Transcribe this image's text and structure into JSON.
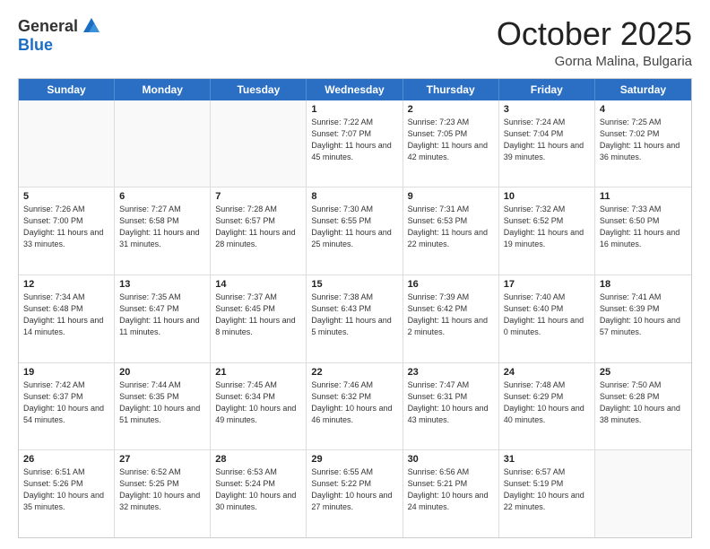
{
  "header": {
    "logo": {
      "general": "General",
      "blue": "Blue"
    },
    "title": "October 2025",
    "subtitle": "Gorna Malina, Bulgaria"
  },
  "days": [
    "Sunday",
    "Monday",
    "Tuesday",
    "Wednesday",
    "Thursday",
    "Friday",
    "Saturday"
  ],
  "weeks": [
    [
      {
        "date": "",
        "info": ""
      },
      {
        "date": "",
        "info": ""
      },
      {
        "date": "",
        "info": ""
      },
      {
        "date": "1",
        "info": "Sunrise: 7:22 AM\nSunset: 7:07 PM\nDaylight: 11 hours and 45 minutes."
      },
      {
        "date": "2",
        "info": "Sunrise: 7:23 AM\nSunset: 7:05 PM\nDaylight: 11 hours and 42 minutes."
      },
      {
        "date": "3",
        "info": "Sunrise: 7:24 AM\nSunset: 7:04 PM\nDaylight: 11 hours and 39 minutes."
      },
      {
        "date": "4",
        "info": "Sunrise: 7:25 AM\nSunset: 7:02 PM\nDaylight: 11 hours and 36 minutes."
      }
    ],
    [
      {
        "date": "5",
        "info": "Sunrise: 7:26 AM\nSunset: 7:00 PM\nDaylight: 11 hours and 33 minutes."
      },
      {
        "date": "6",
        "info": "Sunrise: 7:27 AM\nSunset: 6:58 PM\nDaylight: 11 hours and 31 minutes."
      },
      {
        "date": "7",
        "info": "Sunrise: 7:28 AM\nSunset: 6:57 PM\nDaylight: 11 hours and 28 minutes."
      },
      {
        "date": "8",
        "info": "Sunrise: 7:30 AM\nSunset: 6:55 PM\nDaylight: 11 hours and 25 minutes."
      },
      {
        "date": "9",
        "info": "Sunrise: 7:31 AM\nSunset: 6:53 PM\nDaylight: 11 hours and 22 minutes."
      },
      {
        "date": "10",
        "info": "Sunrise: 7:32 AM\nSunset: 6:52 PM\nDaylight: 11 hours and 19 minutes."
      },
      {
        "date": "11",
        "info": "Sunrise: 7:33 AM\nSunset: 6:50 PM\nDaylight: 11 hours and 16 minutes."
      }
    ],
    [
      {
        "date": "12",
        "info": "Sunrise: 7:34 AM\nSunset: 6:48 PM\nDaylight: 11 hours and 14 minutes."
      },
      {
        "date": "13",
        "info": "Sunrise: 7:35 AM\nSunset: 6:47 PM\nDaylight: 11 hours and 11 minutes."
      },
      {
        "date": "14",
        "info": "Sunrise: 7:37 AM\nSunset: 6:45 PM\nDaylight: 11 hours and 8 minutes."
      },
      {
        "date": "15",
        "info": "Sunrise: 7:38 AM\nSunset: 6:43 PM\nDaylight: 11 hours and 5 minutes."
      },
      {
        "date": "16",
        "info": "Sunrise: 7:39 AM\nSunset: 6:42 PM\nDaylight: 11 hours and 2 minutes."
      },
      {
        "date": "17",
        "info": "Sunrise: 7:40 AM\nSunset: 6:40 PM\nDaylight: 11 hours and 0 minutes."
      },
      {
        "date": "18",
        "info": "Sunrise: 7:41 AM\nSunset: 6:39 PM\nDaylight: 10 hours and 57 minutes."
      }
    ],
    [
      {
        "date": "19",
        "info": "Sunrise: 7:42 AM\nSunset: 6:37 PM\nDaylight: 10 hours and 54 minutes."
      },
      {
        "date": "20",
        "info": "Sunrise: 7:44 AM\nSunset: 6:35 PM\nDaylight: 10 hours and 51 minutes."
      },
      {
        "date": "21",
        "info": "Sunrise: 7:45 AM\nSunset: 6:34 PM\nDaylight: 10 hours and 49 minutes."
      },
      {
        "date": "22",
        "info": "Sunrise: 7:46 AM\nSunset: 6:32 PM\nDaylight: 10 hours and 46 minutes."
      },
      {
        "date": "23",
        "info": "Sunrise: 7:47 AM\nSunset: 6:31 PM\nDaylight: 10 hours and 43 minutes."
      },
      {
        "date": "24",
        "info": "Sunrise: 7:48 AM\nSunset: 6:29 PM\nDaylight: 10 hours and 40 minutes."
      },
      {
        "date": "25",
        "info": "Sunrise: 7:50 AM\nSunset: 6:28 PM\nDaylight: 10 hours and 38 minutes."
      }
    ],
    [
      {
        "date": "26",
        "info": "Sunrise: 6:51 AM\nSunset: 5:26 PM\nDaylight: 10 hours and 35 minutes."
      },
      {
        "date": "27",
        "info": "Sunrise: 6:52 AM\nSunset: 5:25 PM\nDaylight: 10 hours and 32 minutes."
      },
      {
        "date": "28",
        "info": "Sunrise: 6:53 AM\nSunset: 5:24 PM\nDaylight: 10 hours and 30 minutes."
      },
      {
        "date": "29",
        "info": "Sunrise: 6:55 AM\nSunset: 5:22 PM\nDaylight: 10 hours and 27 minutes."
      },
      {
        "date": "30",
        "info": "Sunrise: 6:56 AM\nSunset: 5:21 PM\nDaylight: 10 hours and 24 minutes."
      },
      {
        "date": "31",
        "info": "Sunrise: 6:57 AM\nSunset: 5:19 PM\nDaylight: 10 hours and 22 minutes."
      },
      {
        "date": "",
        "info": ""
      }
    ]
  ]
}
